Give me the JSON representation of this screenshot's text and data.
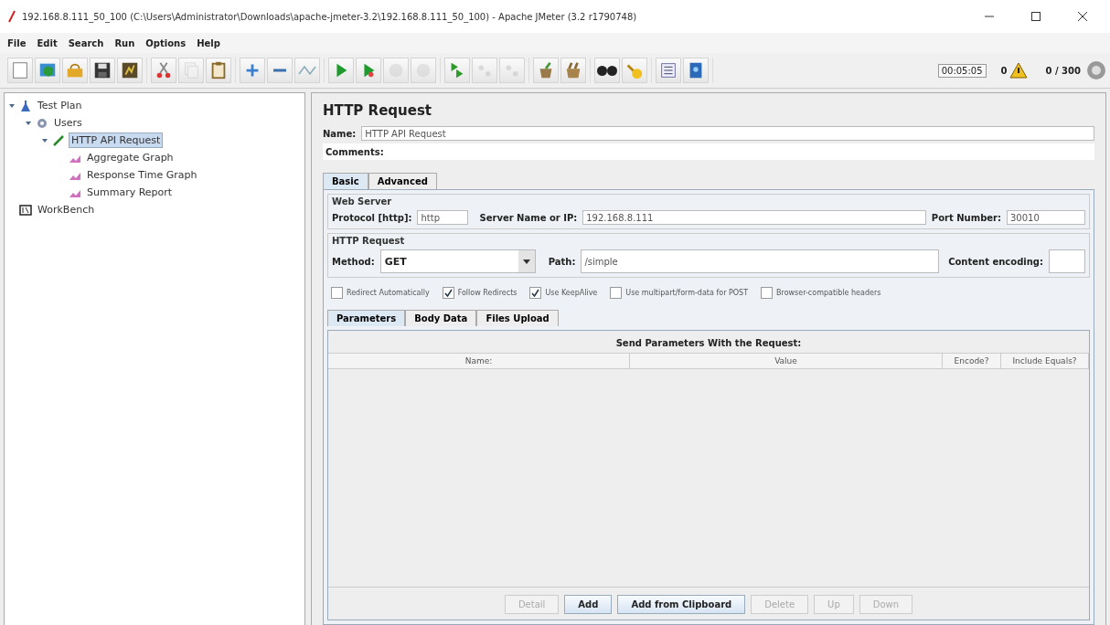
{
  "window": {
    "title": "192.168.8.111_50_100 (C:\\Users\\Administrator\\Downloads\\apache-jmeter-3.2\\192.168.8.111_50_100) - Apache JMeter (3.2 r1790748)"
  },
  "menu": [
    "File",
    "Edit",
    "Search",
    "Run",
    "Options",
    "Help"
  ],
  "toolbar": {
    "buttons": [
      {
        "disabled": false
      },
      {
        "disabled": false
      },
      {
        "disabled": false
      },
      {
        "disabled": false
      },
      {
        "disabled": false
      },
      {
        "disabled": false
      },
      {
        "disabled": true
      },
      {
        "disabled": false
      },
      {
        "disabled": false
      },
      {
        "disabled": false
      },
      {
        "disabled": false
      },
      {
        "disabled": false
      },
      {
        "disabled": false
      },
      {
        "disabled": true
      },
      {
        "disabled": true
      },
      {
        "disabled": false
      },
      {
        "disabled": true
      },
      {
        "disabled": true
      },
      {
        "disabled": false
      },
      {
        "disabled": false
      },
      {
        "disabled": false
      },
      {
        "disabled": false
      },
      {
        "disabled": false
      },
      {
        "disabled": false
      }
    ],
    "timer": "00:05:05",
    "warnings": "0",
    "threads": "0 / 300"
  },
  "tree": [
    {
      "label": "Test Plan",
      "expanded": true,
      "selected": false,
      "children": [
        {
          "label": "Users",
          "expanded": true,
          "selected": false,
          "children": [
            {
              "label": "HTTP API Request",
              "expanded": true,
              "selected": true,
              "children": [
                {
                  "label": "Aggregate Graph",
                  "selected": false
                },
                {
                  "label": "Response Time Graph",
                  "selected": false
                },
                {
                  "label": "Summary Report",
                  "selected": false
                }
              ]
            }
          ]
        }
      ]
    },
    {
      "label": "WorkBench",
      "selected": false
    }
  ],
  "panel": {
    "title": "HTTP Request",
    "name_label": "Name:",
    "name_value": "HTTP API Request",
    "comments_label": "Comments:",
    "tabs": [
      {
        "label": "Basic",
        "selected": true
      },
      {
        "label": "Advanced",
        "selected": false
      }
    ],
    "web_server": {
      "title": "Web Server",
      "protocol_label": "Protocol [http]:",
      "protocol": "http",
      "server_label": "Server Name or IP:",
      "server": "192.168.8.111",
      "port_label": "Port Number:",
      "port": "30010"
    },
    "http_request": {
      "title": "HTTP Request",
      "method_label": "Method:",
      "method": "GET",
      "path_label": "Path:",
      "path": "/simple",
      "encoding_label": "Content encoding:"
    },
    "options": [
      {
        "label": "Redirect Automatically",
        "checked": false
      },
      {
        "label": "Follow Redirects",
        "checked": true
      },
      {
        "label": "Use KeepAlive",
        "checked": true
      },
      {
        "label": "Use multipart/form-data for POST",
        "checked": false
      },
      {
        "label": "Browser-compatible headers",
        "checked": false
      }
    ],
    "sub_tabs": [
      {
        "label": "Parameters",
        "selected": true
      },
      {
        "label": "Body Data",
        "selected": false
      },
      {
        "label": "Files Upload",
        "selected": false
      }
    ],
    "table": {
      "title": "Send Parameters With the Request:",
      "columns": [
        "Name:",
        "Value",
        "Encode?",
        "Include Equals?"
      ]
    },
    "buttons": [
      {
        "label": "Detail",
        "disabled": true
      },
      {
        "label": "Add",
        "disabled": false
      },
      {
        "label": "Add from Clipboard",
        "disabled": false
      },
      {
        "label": "Delete",
        "disabled": true
      },
      {
        "label": "Up",
        "disabled": true
      },
      {
        "label": "Down",
        "disabled": true
      }
    ]
  }
}
